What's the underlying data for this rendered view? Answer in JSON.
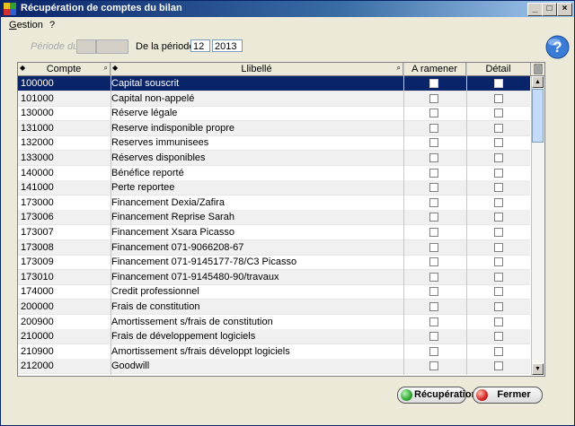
{
  "window": {
    "title": "Récupération de comptes du bilan"
  },
  "menu": [
    {
      "label": "Gestion",
      "accel": "G",
      "rest": "estion"
    },
    {
      "label": "?"
    }
  ],
  "period": {
    "from_label": "Période du",
    "to_label": "De la période",
    "month": "12",
    "year": "2013"
  },
  "table": {
    "columns": [
      "Compte",
      "Llibellé",
      "A ramener",
      "Détail"
    ],
    "rows": [
      {
        "code": "100000",
        "label": "Capital souscrit",
        "selected": true
      },
      {
        "code": "101000",
        "label": "Capital non-appelé"
      },
      {
        "code": "130000",
        "label": "Réserve légale"
      },
      {
        "code": "131000",
        "label": "Reserve indisponible propre"
      },
      {
        "code": "132000",
        "label": "Reserves immunisees"
      },
      {
        "code": "133000",
        "label": "Réserves disponibles"
      },
      {
        "code": "140000",
        "label": "Bénéfice reporté"
      },
      {
        "code": "141000",
        "label": "Perte reportee"
      },
      {
        "code": "173000",
        "label": "Financement Dexia/Zafira"
      },
      {
        "code": "173006",
        "label": "Financement Reprise Sarah"
      },
      {
        "code": "173007",
        "label": "Financement Xsara Picasso"
      },
      {
        "code": "173008",
        "label": "Financement 071-9066208-67"
      },
      {
        "code": "173009",
        "label": "Financement 071-9145177-78/C3 Picasso"
      },
      {
        "code": "173010",
        "label": "Financement 071-9145480-90/travaux"
      },
      {
        "code": "174000",
        "label": "Credit professionnel"
      },
      {
        "code": "200000",
        "label": "Frais de constitution"
      },
      {
        "code": "200900",
        "label": "Amortissement s/frais de constitution"
      },
      {
        "code": "210000",
        "label": "Frais de développement logiciels"
      },
      {
        "code": "210900",
        "label": "Amortissement s/frais développt logiciels"
      },
      {
        "code": "212000",
        "label": "Goodwill"
      }
    ]
  },
  "buttons": {
    "recover": "Récupération",
    "close": "Fermer"
  },
  "colors": {
    "selection": "#0a246a",
    "title_start": "#0a246a",
    "recover_icon": "#2eaa2e",
    "close_icon": "#d42020"
  }
}
